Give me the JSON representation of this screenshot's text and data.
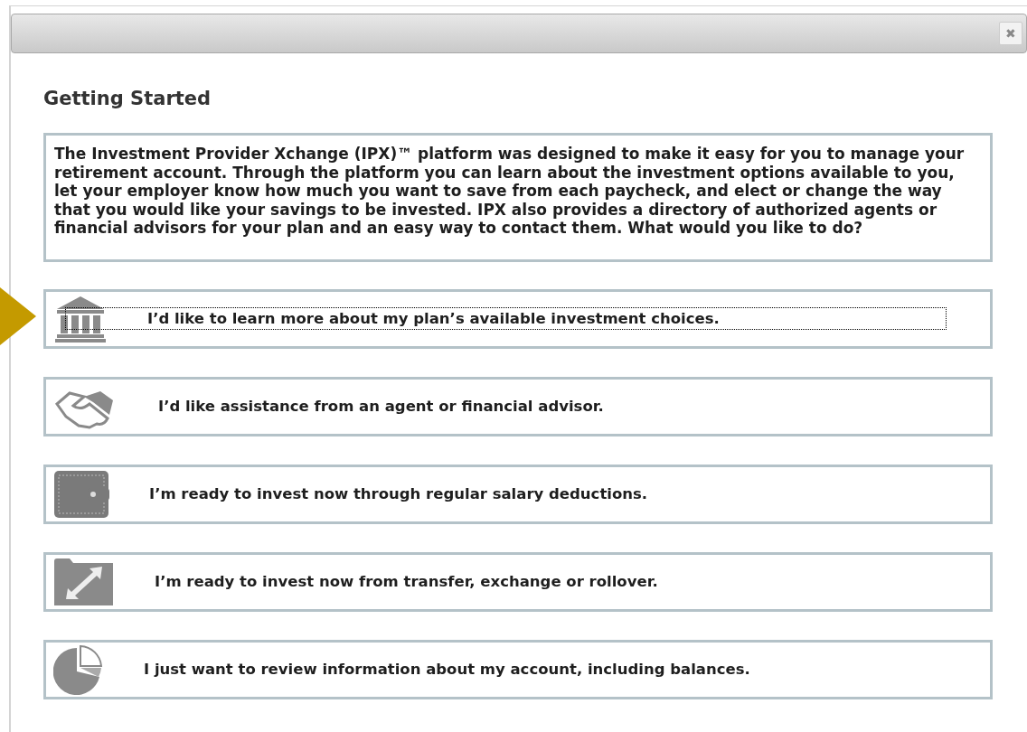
{
  "dialog": {
    "close_label": "✖"
  },
  "heading": "Getting Started",
  "intro": "The Investment Provider Xchange (IPX)™ platform was designed to make it easy for you to manage your retirement account. Through the platform you can learn about the investment options available to you, let your employer know how much you want to save from each paycheck, and elect or change the way that you would like your savings to be invested. IPX also provides a directory of authorized agents or financial advisors for your plan and an easy way to contact them. What would you like to do?",
  "options": [
    {
      "kind": "bank",
      "label": "I’d like to learn more about my plan’s available investment choices.",
      "selected": true
    },
    {
      "kind": "handshake",
      "label": "I’d like assistance from an agent or financial advisor.",
      "selected": false
    },
    {
      "kind": "wallet",
      "label": "I’m ready to invest now through regular salary deductions.",
      "selected": false
    },
    {
      "kind": "transfer",
      "label": "I’m ready to invest now from transfer, exchange or rollover.",
      "selected": false
    },
    {
      "kind": "pie",
      "label": "I just want to review information about my account, including balances.",
      "selected": false
    }
  ]
}
